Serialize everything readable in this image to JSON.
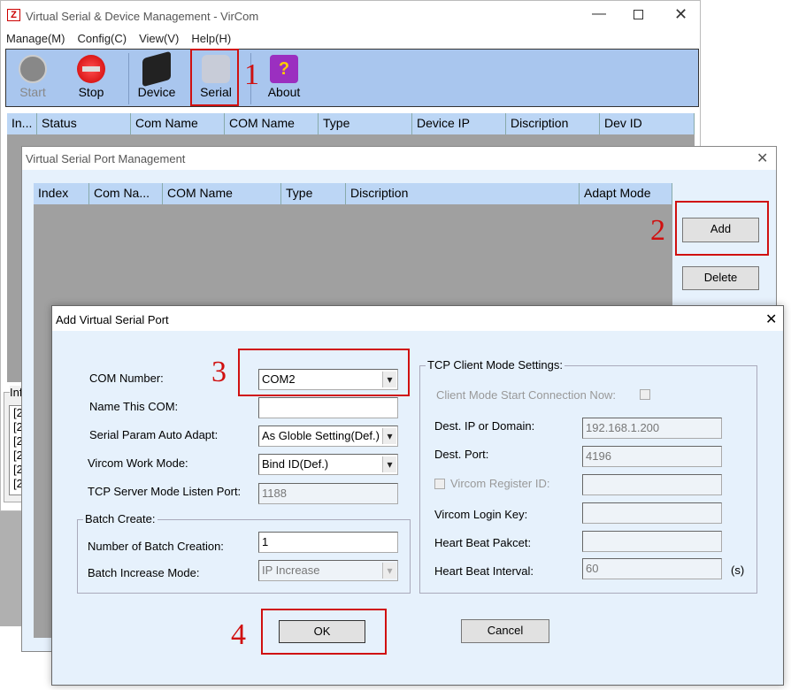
{
  "main": {
    "title": "Virtual Serial & Device Management - VirCom",
    "menu": [
      "Manage(M)",
      "Config(C)",
      "View(V)",
      "Help(H)"
    ],
    "toolbar": [
      {
        "label": "Start",
        "icon": "play-icon"
      },
      {
        "label": "Stop",
        "icon": "stop-icon"
      },
      {
        "label": "Device",
        "icon": "device-icon"
      },
      {
        "label": "Serial",
        "icon": "serial-port-icon"
      },
      {
        "label": "About",
        "icon": "help-book-icon"
      }
    ],
    "columns": [
      "In...",
      "Status",
      "Com Name",
      "COM Name",
      "Type",
      "Device IP",
      "Discription",
      "Dev ID"
    ],
    "info_label": "Inf",
    "info_lines": [
      "[2",
      "[2",
      "[2",
      "[2",
      "[2",
      "[2"
    ]
  },
  "port_mgmt": {
    "title": "Virtual Serial Port Management",
    "columns": [
      "Index",
      "Com Na...",
      "COM Name",
      "Type",
      "Discription",
      "Adapt Mode"
    ],
    "add": "Add",
    "delete": "Delete"
  },
  "add_dialog": {
    "title": "Add Virtual Serial Port",
    "com_number_label": "COM Number:",
    "com_number": "COM2",
    "name_label": "Name This COM:",
    "name_value": "",
    "auto_adapt_label": "Serial Param Auto Adapt:",
    "auto_adapt": "As Globle Setting(Def.)",
    "work_mode_label": "Vircom Work Mode:",
    "work_mode": "Bind ID(Def.)",
    "listen_port_label": "TCP Server Mode Listen Port:",
    "listen_port": "1188",
    "batch_group": "Batch Create:",
    "batch_num_label": "Number of Batch Creation:",
    "batch_num": "1",
    "batch_mode_label": "Batch Increase Mode:",
    "batch_mode": "IP Increase",
    "tcp_group": "TCP Client Mode Settings:",
    "client_start_label": "Client Mode Start Connection Now:",
    "dest_ip_label": "Dest. IP or Domain:",
    "dest_ip": "192.168.1.200",
    "dest_port_label": "Dest. Port:",
    "dest_port": "4196",
    "register_id_label": "Vircom Register ID:",
    "register_id": "",
    "login_key_label": "Vircom Login Key:",
    "login_key": "",
    "heartbeat_packet_label": "Heart Beat Pakcet:",
    "heartbeat_packet": "",
    "heartbeat_interval_label": "Heart Beat Interval:",
    "heartbeat_interval": "60",
    "unit": "(s)",
    "ok": "OK",
    "cancel": "Cancel"
  },
  "steps": [
    "1",
    "2",
    "3",
    "4"
  ],
  "colors": {
    "toolbar": "#a9c6ee",
    "header": "#bcd6f5",
    "dialog": "#e6f1fc",
    "annotation": "#d01010"
  }
}
